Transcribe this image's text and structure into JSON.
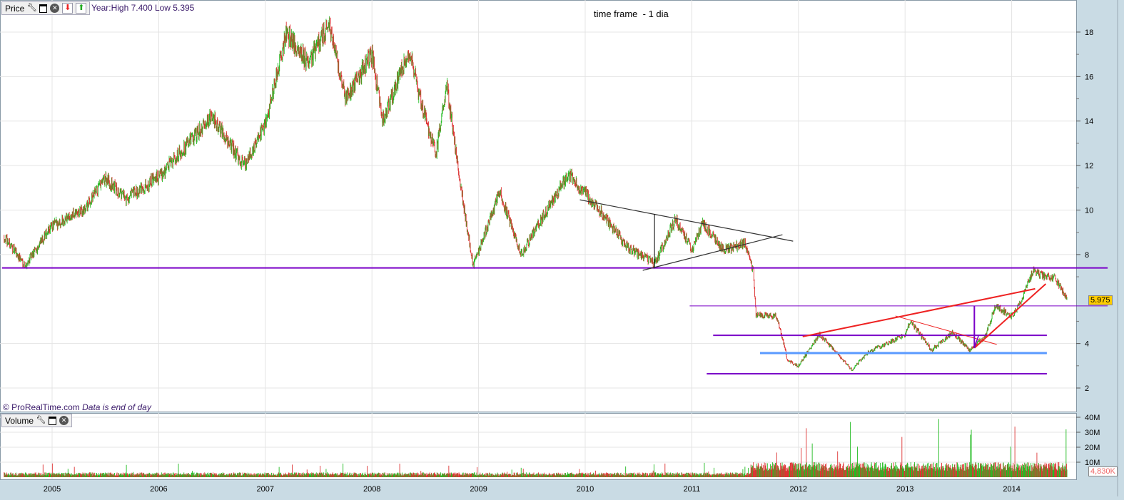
{
  "price_panel": {
    "label": "Price",
    "year_info": "Year:High 7.400 Low 5.395",
    "title": "time frame  - 1 dia",
    "copyright": "© ProRealTime.com",
    "data_note": "Data is end of day",
    "current_price": "5.975",
    "icons": [
      "wrench-icon",
      "maximize-icon",
      "close-icon",
      "move-down-icon",
      "move-up-icon"
    ]
  },
  "volume_panel": {
    "label": "Volume",
    "current_volume": "4,830K",
    "icons": [
      "wrench-icon",
      "maximize-icon",
      "close-icon"
    ]
  },
  "colors": {
    "up": "#22bb22",
    "down": "#dd3333",
    "purple": "#7a00c8",
    "blue": "#5a9aff",
    "red": "#ee2222",
    "axis_bg": "#c9dbe4",
    "price_tag": "#ffcc00"
  },
  "chart_data": {
    "type": "line",
    "title": "time frame  - 1 dia",
    "x_ticks": [
      "2005",
      "2006",
      "2007",
      "2008",
      "2009",
      "2010",
      "2011",
      "2012",
      "2013",
      "2014"
    ],
    "xlim": [
      2004.53,
      2014.9
    ],
    "price_ylim": [
      1.0,
      19.0
    ],
    "price_ticks": [
      "2",
      "4",
      "8",
      "10",
      "12",
      "14",
      "16",
      "18"
    ],
    "volume_ticks": [
      "10M",
      "20M",
      "30M",
      "40M"
    ],
    "price_keypoints": [
      [
        2004.55,
        8.8
      ],
      [
        2004.75,
        7.5
      ],
      [
        2005.0,
        9.3
      ],
      [
        2005.3,
        10.0
      ],
      [
        2005.5,
        11.4
      ],
      [
        2005.7,
        10.5
      ],
      [
        2006.0,
        11.5
      ],
      [
        2006.5,
        14.2
      ],
      [
        2006.8,
        12.0
      ],
      [
        2007.0,
        13.8
      ],
      [
        2007.2,
        18.0
      ],
      [
        2007.4,
        16.6
      ],
      [
        2007.6,
        18.4
      ],
      [
        2007.75,
        15.0
      ],
      [
        2008.0,
        17.0
      ],
      [
        2008.1,
        14.0
      ],
      [
        2008.35,
        17.2
      ],
      [
        2008.45,
        15.0
      ],
      [
        2008.6,
        12.5
      ],
      [
        2008.7,
        15.7
      ],
      [
        2008.85,
        10.5
      ],
      [
        2008.95,
        7.5
      ],
      [
        2009.2,
        10.8
      ],
      [
        2009.4,
        8.0
      ],
      [
        2009.7,
        10.5
      ],
      [
        2009.85,
        11.6
      ],
      [
        2010.1,
        10.2
      ],
      [
        2010.4,
        8.3
      ],
      [
        2010.65,
        7.6
      ],
      [
        2010.85,
        9.6
      ],
      [
        2011.0,
        8.2
      ],
      [
        2011.1,
        9.4
      ],
      [
        2011.3,
        8.2
      ],
      [
        2011.5,
        8.5
      ],
      [
        2011.58,
        7.2
      ],
      [
        2011.6,
        5.3
      ],
      [
        2011.8,
        5.2
      ],
      [
        2011.9,
        3.2
      ],
      [
        2012.0,
        3.0
      ],
      [
        2012.2,
        4.4
      ],
      [
        2012.5,
        2.8
      ],
      [
        2012.65,
        3.6
      ],
      [
        2013.0,
        4.4
      ],
      [
        2013.05,
        5.0
      ],
      [
        2013.25,
        3.7
      ],
      [
        2013.45,
        4.5
      ],
      [
        2013.6,
        3.7
      ],
      [
        2013.75,
        4.3
      ],
      [
        2013.85,
        5.7
      ],
      [
        2014.0,
        5.2
      ],
      [
        2014.1,
        6.0
      ],
      [
        2014.2,
        7.3
      ],
      [
        2014.3,
        7.0
      ],
      [
        2014.4,
        7.0
      ],
      [
        2014.52,
        5.975
      ]
    ],
    "annotations": [
      {
        "name": "support-7-4",
        "color": "purple",
        "width": 2,
        "from": [
          2004.53,
          7.4
        ],
        "to": [
          2014.9,
          7.4
        ]
      },
      {
        "name": "triangle-top",
        "color": "#333333",
        "width": 1.2,
        "from": [
          2009.95,
          10.46
        ],
        "to": [
          2011.95,
          8.6
        ]
      },
      {
        "name": "triangle-bottom",
        "color": "#333333",
        "width": 1.2,
        "from": [
          2010.54,
          7.29
        ],
        "to": [
          2011.85,
          8.89
        ]
      },
      {
        "name": "triangle-height",
        "color": "#000000",
        "width": 1,
        "from": [
          2010.65,
          9.82
        ],
        "to": [
          2010.65,
          7.42
        ]
      },
      {
        "name": "level-5-7",
        "color": "purple",
        "width": 1,
        "from": [
          2010.98,
          5.69
        ],
        "to": [
          2014.9,
          5.69
        ]
      },
      {
        "name": "level-4-37",
        "color": "purple",
        "width": 2,
        "from": [
          2011.2,
          4.37
        ],
        "to": [
          2014.33,
          4.37
        ]
      },
      {
        "name": "level-3-57",
        "color": "blue",
        "width": 3,
        "from": [
          2011.64,
          3.57
        ],
        "to": [
          2014.33,
          3.57
        ]
      },
      {
        "name": "level-2-64",
        "color": "purple",
        "width": 2,
        "from": [
          2011.14,
          2.64
        ],
        "to": [
          2014.33,
          2.64
        ]
      },
      {
        "name": "trend-upper",
        "color": "red",
        "width": 2,
        "from": [
          2012.04,
          4.31
        ],
        "to": [
          2014.22,
          6.46
        ]
      },
      {
        "name": "trend-steep",
        "color": "red",
        "width": 2,
        "from": [
          2013.65,
          3.8
        ],
        "to": [
          2014.32,
          6.68
        ]
      },
      {
        "name": "trend-down-thin",
        "color": "red",
        "width": 1,
        "from": [
          2012.91,
          5.24
        ],
        "to": [
          2013.86,
          3.96
        ]
      },
      {
        "name": "breakout-height",
        "color": "purple",
        "width": 2,
        "from": [
          2013.65,
          5.69
        ],
        "to": [
          2013.65,
          3.8
        ]
      }
    ]
  }
}
